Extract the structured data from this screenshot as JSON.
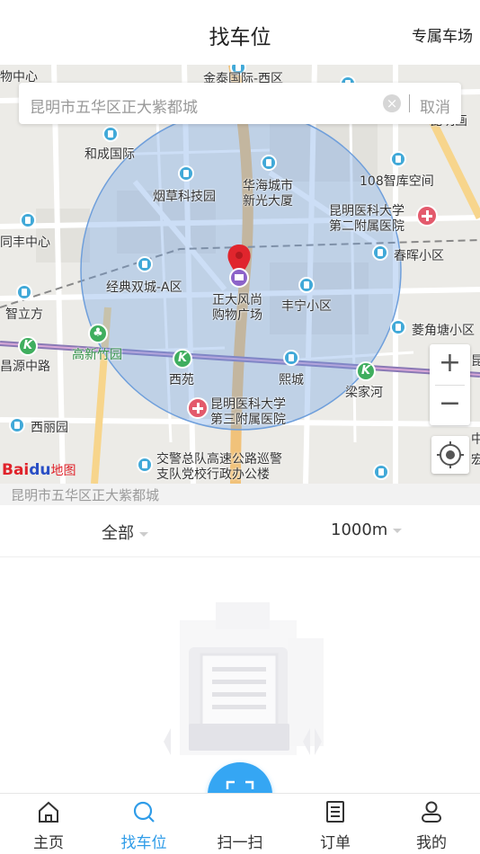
{
  "header": {
    "title": "找车位",
    "right_link": "专属车场"
  },
  "search": {
    "value": "昆明市五华区正大紫都城",
    "cancel_label": "取消"
  },
  "map": {
    "pois": [
      {
        "name": "和成国际",
        "kind": "building"
      },
      {
        "name": "烟草科技园",
        "kind": "building"
      },
      {
        "name": "华海城市",
        "kind": "building"
      },
      {
        "name": "新光大厦",
        "kind": "building"
      },
      {
        "name": "108智库空间",
        "kind": "building"
      },
      {
        "name": "昆明医科大学",
        "kind": "hospital"
      },
      {
        "name": "第二附属医院",
        "kind": "hospital"
      },
      {
        "name": "春晖小区",
        "kind": "building"
      },
      {
        "name": "经典双城-A区",
        "kind": "building"
      },
      {
        "name": "正大风尚",
        "kind": "mall"
      },
      {
        "name": "购物广场",
        "kind": "mall"
      },
      {
        "name": "丰宁小区",
        "kind": "building"
      },
      {
        "name": "菱角塘小区",
        "kind": "building"
      },
      {
        "name": "智立方",
        "kind": "building"
      },
      {
        "name": "高新竹园",
        "kind": "metro"
      },
      {
        "name": "昌源中路",
        "kind": "metro"
      },
      {
        "name": "西苑",
        "kind": "metro"
      },
      {
        "name": "熙城",
        "kind": "building"
      },
      {
        "name": "梁家河",
        "kind": "metro"
      },
      {
        "name": "昆明医科大学",
        "kind": "hospital"
      },
      {
        "name": "第三附属医院",
        "kind": "hospital"
      },
      {
        "name": "西丽园",
        "kind": "building"
      },
      {
        "name": "交警总队高速公路巡警",
        "kind": "building"
      },
      {
        "name": "支队党校行政办公楼",
        "kind": "building"
      },
      {
        "name": "物中心",
        "kind": "partial"
      },
      {
        "name": "金泰国际-西区",
        "kind": "partial"
      },
      {
        "name": "昆明画",
        "kind": "partial"
      },
      {
        "name": "同丰中心",
        "kind": "partial"
      },
      {
        "name": "昆",
        "kind": "partial"
      },
      {
        "name": "中",
        "kind": "partial"
      },
      {
        "name": "宏",
        "kind": "partial"
      }
    ],
    "zoom_in": "+",
    "zoom_out": "−",
    "logo_brand": "Bai",
    "logo_du": "du",
    "logo_map": "地图",
    "radius_color": "#8fb6e8",
    "pin_color": "#e0252d"
  },
  "location_label": "昆明市五华区正大紫都城",
  "filters": {
    "type": "全部",
    "distance": "1000m"
  },
  "tabs": [
    {
      "label": "主页",
      "icon": "home-icon"
    },
    {
      "label": "找车位",
      "icon": "search-icon"
    },
    {
      "label": "扫一扫",
      "icon": "scan-icon"
    },
    {
      "label": "订单",
      "icon": "order-icon"
    },
    {
      "label": "我的",
      "icon": "user-icon"
    }
  ],
  "colors": {
    "accent": "#2f9ce8",
    "fab": "#35a6f3"
  }
}
